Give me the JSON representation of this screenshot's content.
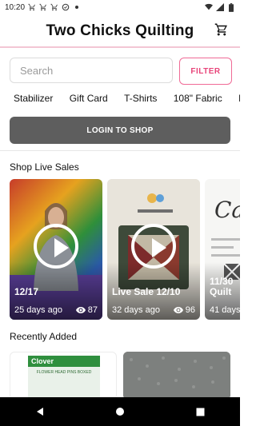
{
  "status_bar": {
    "time": "10:20"
  },
  "header": {
    "title": "Two Chicks Quilting"
  },
  "search": {
    "placeholder": "Search"
  },
  "filter_label": "FILTER",
  "categories": [
    "Stabilizer",
    "Gift Card",
    "T-Shirts",
    "108\" Fabric",
    "Ri"
  ],
  "login_label": "LOGIN TO SHOP",
  "live_sales": {
    "title": "Shop Live Sales",
    "cards": [
      {
        "date": "12/17",
        "ago": "25 days ago",
        "views": "87"
      },
      {
        "date": "Live Sale 12/10",
        "ago": "32 days ago",
        "views": "96"
      },
      {
        "date": "11/30 Quilt",
        "ago": "41 days",
        "views": ""
      }
    ],
    "card3_script": "Ca"
  },
  "recently_added": {
    "title": "Recently Added",
    "item1_brand": "Clover",
    "item1_label": "FLOWER HEAD PINS BOXED"
  },
  "colors": {
    "accent": "#e8457a",
    "login_bg": "#5e5e5e"
  }
}
